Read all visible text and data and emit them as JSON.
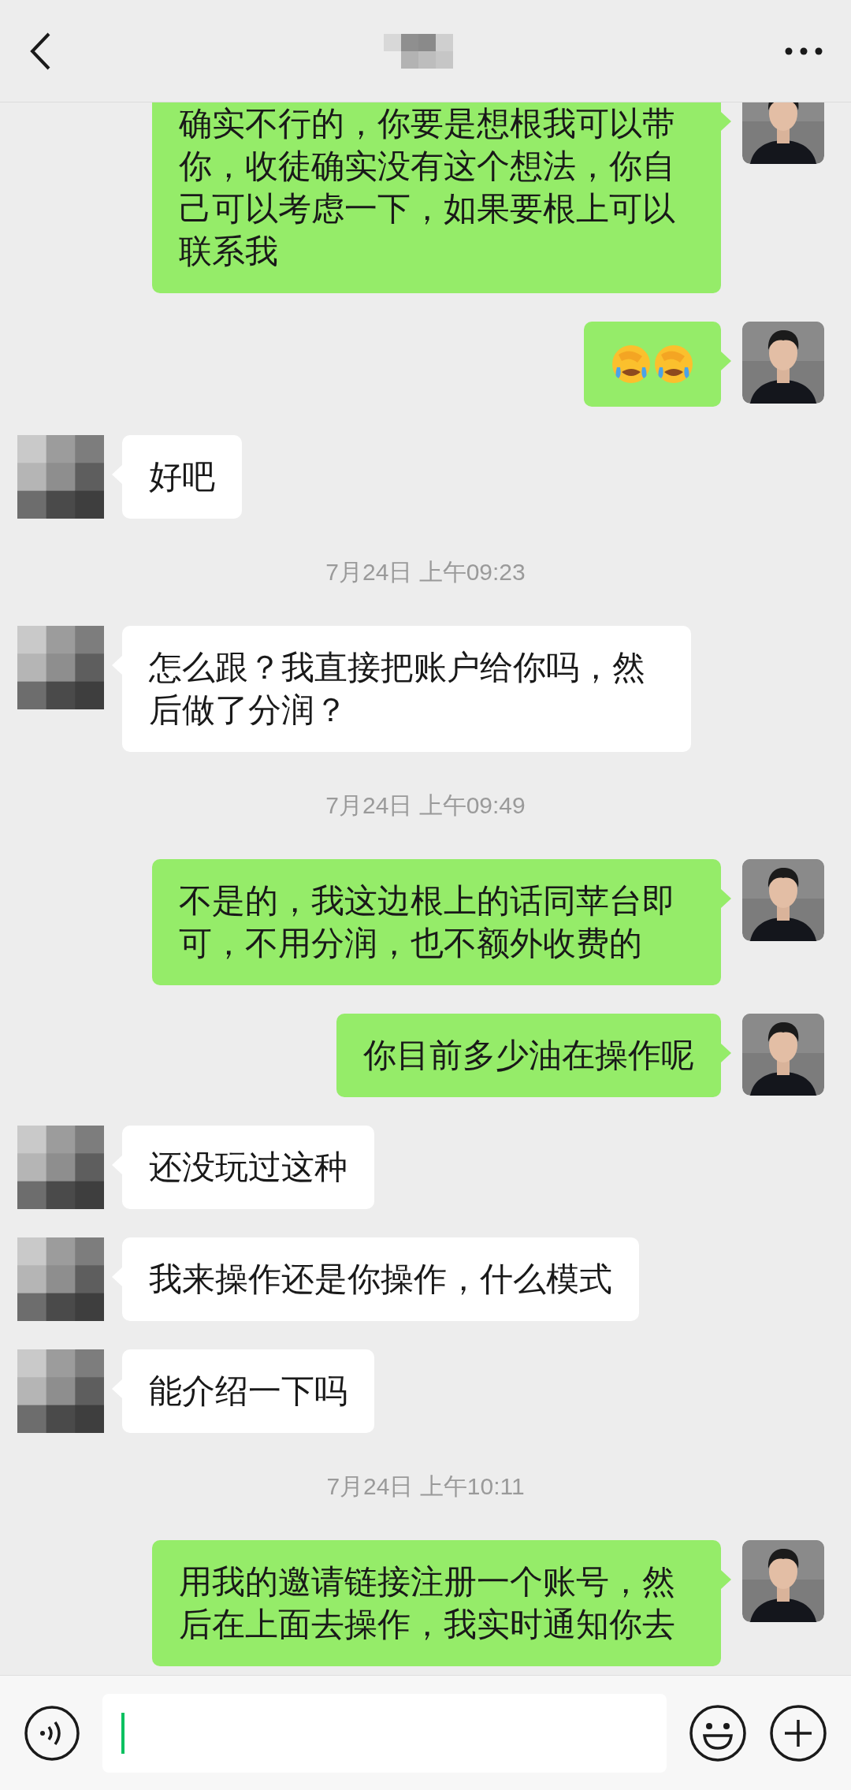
{
  "header": {
    "title_blurred": true
  },
  "messages": [
    {
      "kind": "text",
      "outgoing": true,
      "text": "确实不行的，你要是想根我可以带你，收徒确实没有这个想法，你自己可以考虑一下，如果要根上可以联系我"
    },
    {
      "kind": "emoji",
      "outgoing": true,
      "emojis": [
        {
          "kind": "facepalm"
        },
        {
          "kind": "facepalm"
        }
      ]
    },
    {
      "kind": "text",
      "outgoing": false,
      "text": "好吧"
    },
    {
      "kind": "time",
      "text": "7月24日 上午09:23"
    },
    {
      "kind": "text",
      "outgoing": false,
      "text": "怎么跟？我直接把账户给你吗，然后做了分润？"
    },
    {
      "kind": "time",
      "text": "7月24日 上午09:49"
    },
    {
      "kind": "text",
      "outgoing": true,
      "text": "不是的，我这边根上的话同苹台即可，不用分润，也不额外收费的"
    },
    {
      "kind": "text",
      "outgoing": true,
      "text": "你目前多少油在操作呢"
    },
    {
      "kind": "text",
      "outgoing": false,
      "text": "还没玩过这种"
    },
    {
      "kind": "text",
      "outgoing": false,
      "text": "我来操作还是你操作，什么模式"
    },
    {
      "kind": "text",
      "outgoing": false,
      "text": "能介绍一下吗"
    },
    {
      "kind": "time",
      "text": "7月24日 上午10:11"
    },
    {
      "kind": "text",
      "outgoing": true,
      "text": "用我的邀请链接注册一个账号，然后在上面去操作，我实时通知你去"
    }
  ],
  "input": {
    "focused": true
  }
}
